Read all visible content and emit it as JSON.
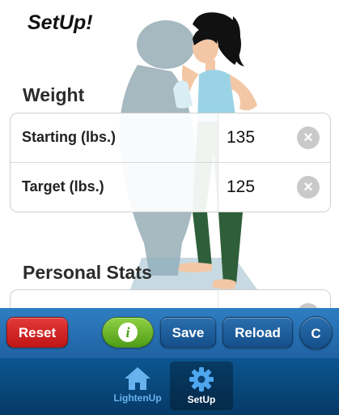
{
  "header": {
    "title": "SetUp!"
  },
  "weight": {
    "heading": "Weight",
    "rows": [
      {
        "label": "Starting (lbs.)",
        "value": "135"
      },
      {
        "label": "Target (lbs.)",
        "value": "125"
      }
    ]
  },
  "personal_stats": {
    "heading": "Personal Stats"
  },
  "toolbar": {
    "reset_label": "Reset",
    "info_label": "i",
    "save_label": "Save",
    "reload_label": "Reload",
    "c_label": "C"
  },
  "tabs": [
    {
      "label": "LightenUp",
      "icon": "home-icon",
      "active": false
    },
    {
      "label": "SetUp",
      "icon": "gear-icon",
      "active": true
    }
  ],
  "colors": {
    "toolbar": "#2a74b8",
    "reset": "#d22a2a",
    "info": "#6cb52c",
    "tab_active": "#ffffff",
    "tab_inactive": "#67b2ef"
  }
}
